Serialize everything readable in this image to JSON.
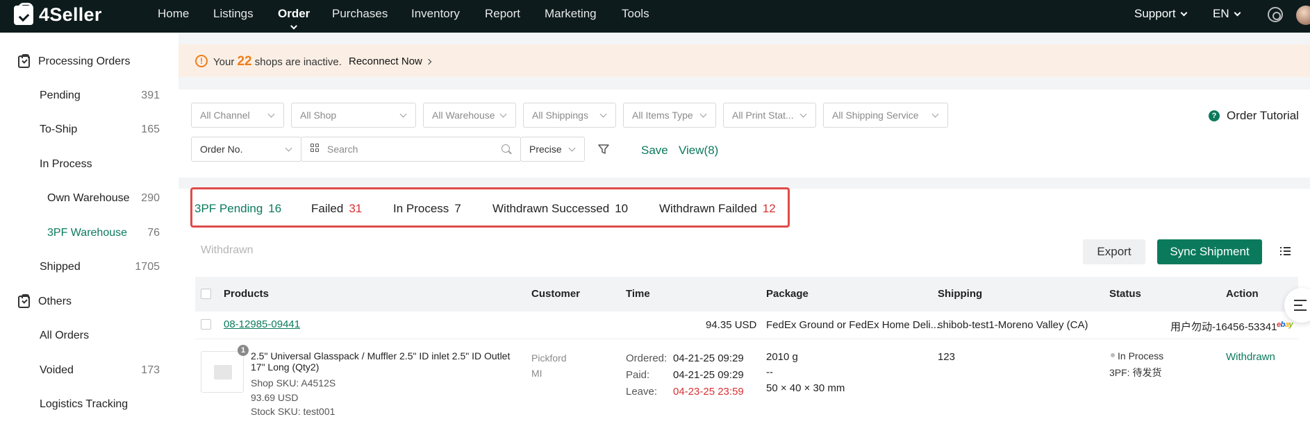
{
  "brand": {
    "name": "4Seller"
  },
  "nav": {
    "items": [
      "Home",
      "Listings",
      "Order",
      "Purchases",
      "Inventory",
      "Report",
      "Marketing",
      "Tools"
    ],
    "active": "Order",
    "support": "Support",
    "language": "EN"
  },
  "sidebar": {
    "processing_label": "Processing Orders",
    "pending": {
      "label": "Pending",
      "count": "391"
    },
    "to_ship": {
      "label": "To-Ship",
      "count": "165"
    },
    "in_process": {
      "label": "In Process"
    },
    "own_warehouse": {
      "label": "Own Warehouse",
      "count": "290"
    },
    "tpf_warehouse": {
      "label": "3PF Warehouse",
      "count": "76"
    },
    "shipped": {
      "label": "Shipped",
      "count": "1705"
    },
    "others_label": "Others",
    "all_orders": {
      "label": "All Orders"
    },
    "voided": {
      "label": "Voided",
      "count": "173"
    },
    "logistics": {
      "label": "Logistics Tracking"
    }
  },
  "banner": {
    "prefix": "Your",
    "count": "22",
    "suffix": "shops are inactive.",
    "action": "Reconnect Now"
  },
  "filters": {
    "channel": "All Channel",
    "shop": "All Shop",
    "warehouse": "All Warehouse",
    "shippings": "All Shippings",
    "items_type": "All Items Type",
    "print_status": "All Print Stat...",
    "shipping_service": "All Shipping Service",
    "order_field": "Order No.",
    "search_placeholder": "Search",
    "match_mode": "Precise",
    "save": "Save",
    "view": "View(8)",
    "tutorial": "Order Tutorial"
  },
  "tabs": [
    {
      "label": "3PF Pending",
      "count": "16"
    },
    {
      "label": "Failed",
      "count": "31"
    },
    {
      "label": "In Process",
      "count": "7"
    },
    {
      "label": "Withdrawn Successed",
      "count": "10"
    },
    {
      "label": "Withdrawn Failded",
      "count": "12"
    }
  ],
  "toolbar": {
    "withdrawn": "Withdrawn",
    "export": "Export",
    "sync": "Sync Shipment"
  },
  "table": {
    "headers": [
      "Products",
      "Customer",
      "Time",
      "Package",
      "Shipping",
      "Status",
      "Action"
    ],
    "order": {
      "number": "08-12985-09441",
      "amount": "94.35 USD",
      "service": "FedEx Ground or FedEx Home Deli...",
      "warehouse": "shibob-test1-Moreno Valley (CA)",
      "buyer": "用户勿动-16456-53341",
      "platform": "ebay"
    },
    "item": {
      "qty_badge": "1",
      "title": "2.5\" Universal Glasspack / Muffler 2.5\" ID inlet 2.5\" ID Outlet 17\" Long (Qty2)",
      "shop_sku": "Shop SKU: A4512S",
      "price": "93.69 USD",
      "stock_sku": "Stock SKU: test001",
      "customer_name": "Pickford",
      "customer_state": "MI",
      "ordered_label": "Ordered:",
      "ordered": "04-21-25 09:29",
      "paid_label": "Paid:",
      "paid": "04-21-25 09:29",
      "leave_label": "Leave:",
      "leave": "04-23-25 23:59",
      "weight": "2010 g",
      "weight_extra": "--",
      "dimensions": "50 × 40 × 30 mm",
      "tracking": "123",
      "status": "In Process",
      "substatus": "3PF: 待发货",
      "action": "Withdrawn"
    }
  },
  "colors": {
    "accent": "#0b7a5c",
    "alert": "#d93030",
    "warning": "#f07d18",
    "nav_bg": "#0d1b1c"
  }
}
